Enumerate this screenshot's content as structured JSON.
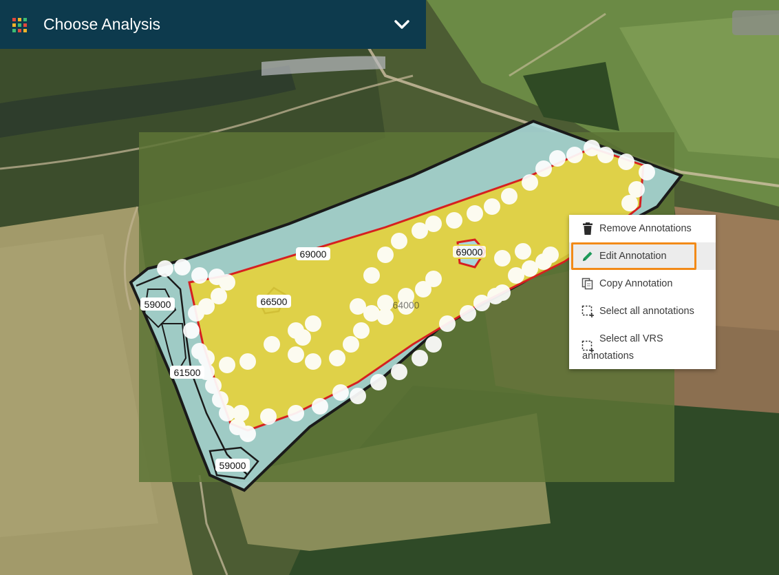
{
  "header": {
    "title": "Choose Analysis",
    "icon": "grid-apps-icon",
    "toggle_icon": "chevron-down-icon"
  },
  "map": {
    "zone_labels": [
      "69000",
      "66500",
      "59000",
      "61500",
      "59000",
      "69000",
      "64000"
    ]
  },
  "context_menu": {
    "items": [
      {
        "label": "Remove Annotations",
        "icon": "trash-icon"
      },
      {
        "label": "Edit Annotation",
        "icon": "pencil-icon"
      },
      {
        "label": "Copy Annotation",
        "icon": "copy-icon"
      },
      {
        "label": "Select all annotations",
        "icon": "select-area-icon"
      },
      {
        "label": "Select all VRS",
        "label_line2": "annotations",
        "icon": "select-area-icon"
      }
    ],
    "highlight_color": "#f28a18"
  },
  "colors": {
    "header_bg": "#0d3a4d",
    "zone_fill": "#9fd3d8",
    "annotation_fill": "#e5d23a",
    "annotation_edge": "#d62020",
    "pencil": "#1e9a5a"
  }
}
